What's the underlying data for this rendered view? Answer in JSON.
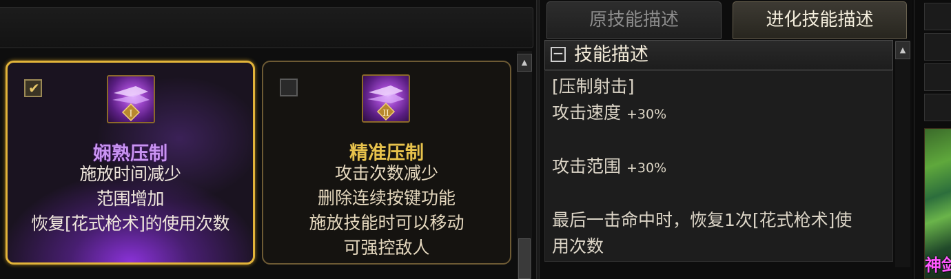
{
  "cards": [
    {
      "title": "娴熟压制",
      "checked": true,
      "rank_numeral": "I",
      "lines": [
        "施放时间减少",
        "范围增加",
        "恢复[花式枪术]的使用次数"
      ]
    },
    {
      "title": "精准压制",
      "checked": false,
      "rank_numeral": "II",
      "lines": [
        "攻击次数减少",
        "删除连续按键功能",
        "施放技能时可以移动",
        "可强控敌人"
      ]
    }
  ],
  "tabs": {
    "original": "原技能描述",
    "evolved": "进化技能描述"
  },
  "description": {
    "section_title": "技能描述",
    "collapse_symbol": "−",
    "skill_name": "[压制射击]",
    "stats": [
      {
        "label": "攻击速度",
        "value": "+30%"
      },
      {
        "label": "攻击范围",
        "value": "+30%"
      }
    ],
    "effect_lines": [
      "最后一击命中时，恢复1次[花式枪术]使",
      "用次数"
    ]
  },
  "side": {
    "portrait_label": "神剑"
  },
  "scroll_symbols": {
    "up": "▲"
  },
  "colors": {
    "selected_border": "#e2b43a",
    "selected_title": "#c993f2",
    "unselected_title": "#e7c24c"
  }
}
